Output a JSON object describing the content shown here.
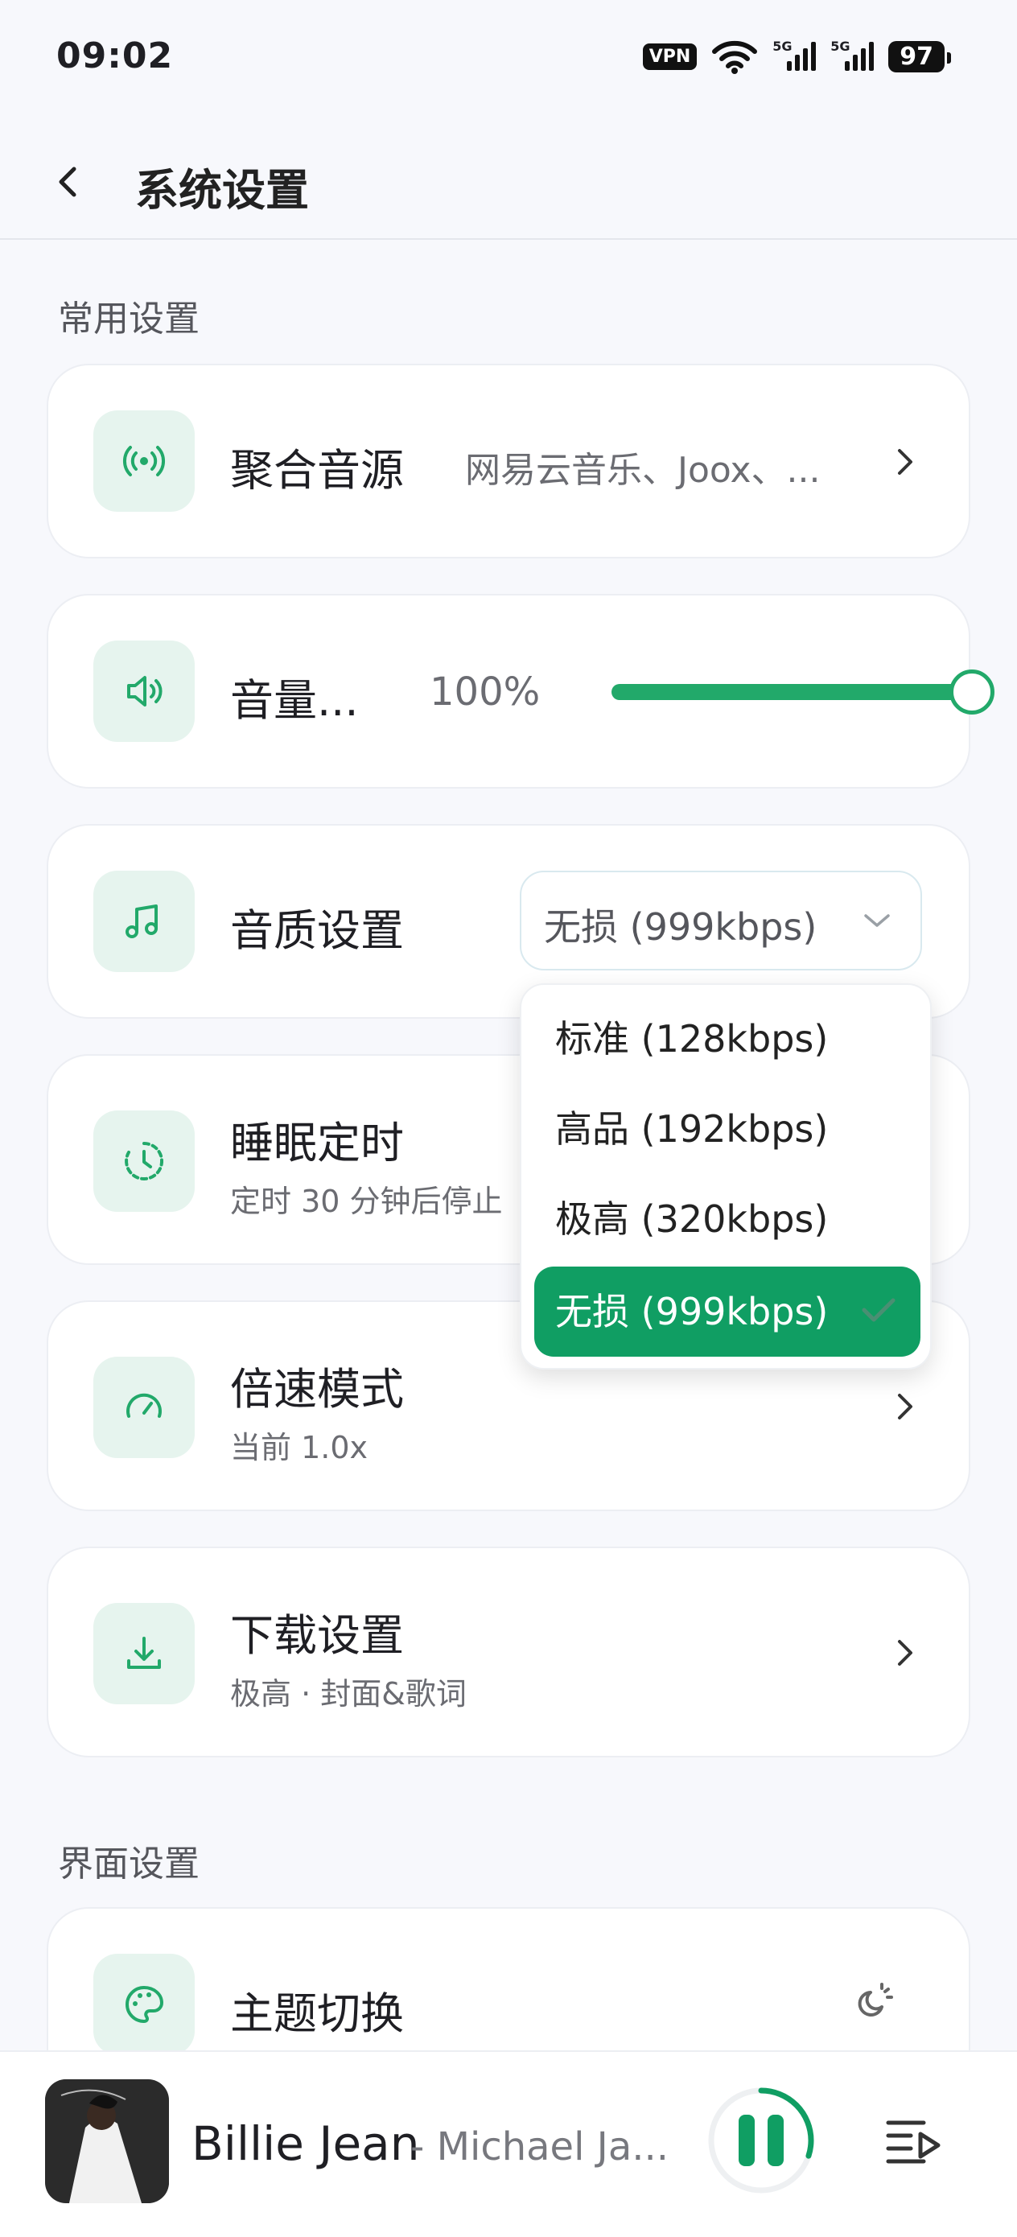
{
  "status_bar": {
    "time": "09:02",
    "vpn": "VPN",
    "net1": "5G",
    "net2": "5G",
    "battery": "97"
  },
  "header": {
    "title": "系统设置"
  },
  "sections": {
    "common": "常用设置",
    "ui": "界面设置"
  },
  "settings": {
    "source": {
      "label": "聚合音源",
      "value": "网易云音乐、Joox、..."
    },
    "volume": {
      "label": "音量...",
      "value_text": "100%",
      "level": 1.0
    },
    "quality": {
      "label": "音质设置",
      "selected": "无损 (999kbps)"
    },
    "sleep": {
      "label": "睡眠定时",
      "sub": "定时 30 分钟后停止"
    },
    "speed": {
      "label": "倍速模式",
      "sub": "当前 1.0x"
    },
    "download": {
      "label": "下载设置",
      "sub": "极高 · 封面&歌词"
    },
    "theme": {
      "label": "主题切换"
    }
  },
  "quality_menu": {
    "options": [
      "标准 (128kbps)",
      "高品 (192kbps)",
      "极高 (320kbps)",
      "无损 (999kbps)"
    ],
    "selected_index": 3
  },
  "player": {
    "song": "Billie Jean",
    "artist": "- Michael Ja...",
    "progress": 0.3
  },
  "colors": {
    "accent": "#109e63",
    "accent_light": "#e6f4ee"
  }
}
